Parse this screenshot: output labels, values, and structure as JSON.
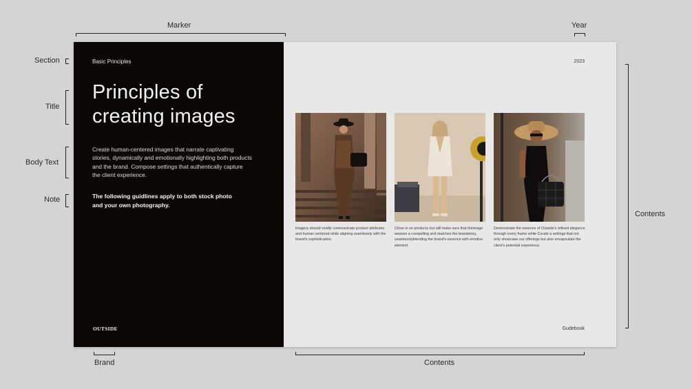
{
  "annotations": {
    "marker": "Marker",
    "year": "Year",
    "section": "Section",
    "title": "Title",
    "body_text": "Body Text",
    "note": "Note",
    "contents_right": "Contents",
    "brand": "Brand",
    "contents_bottom": "Contents"
  },
  "left_page": {
    "section": "Basic Principles",
    "title": "Principles of creating images",
    "body": "Create human-centered images that narrate captivating stories, dynamically and emotionally highlighting both products and the brand. Compose settings that authentically capture the client experience.",
    "note": "The following guidlines apply to both stock photo\n and your own photography.",
    "brand": "OUTSIDE"
  },
  "right_page": {
    "year": "2023",
    "footer": "Gudebook",
    "captions": [
      "imagery should vividly communicate product attributes and human centered while aligning seamlessly with the brand's sophistication.",
      "Close in on products but still make sure that theimage weaves a compelling and matches the brandstory, seamlesslyblending the brand's essence with emotive element.",
      "Demonstrate the essence of Outside's refined elegance through every frame while Curate a settings that not only showcase our offerings but also encapsulate the client's potential experience."
    ]
  },
  "colors": {
    "background": "#d4d4d4",
    "left_page": "#0b0707",
    "right_page": "#e8e8e8",
    "annotation": "#2a2a2a"
  }
}
